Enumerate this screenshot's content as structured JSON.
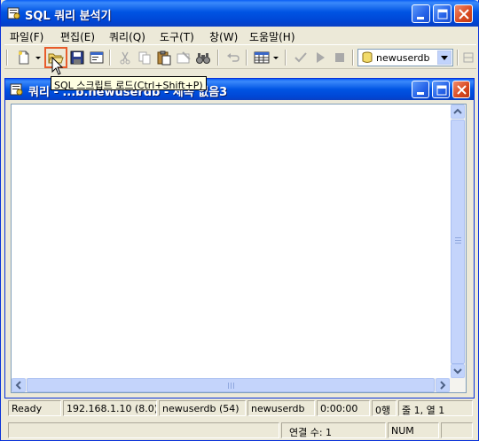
{
  "window": {
    "title": "SQL 쿼리 분석기"
  },
  "menu": [
    "파일(F)",
    "편집(E)",
    "쿼리(Q)",
    "도구(T)",
    "창(W)",
    "도움말(H)"
  ],
  "toolbar": {
    "database": "newuserdb"
  },
  "tooltip": "SQL 스크립트 로드(Ctrl+Shift+P)",
  "child": {
    "title": "쿼리 - ...b.newuserdb - 제목 없음3"
  },
  "status": {
    "state": "Ready",
    "server": "192.168.1.10 (8.0)",
    "user": "newuserdb (54)",
    "db": "newuserdb",
    "time": "0:00:00",
    "rows": "0행",
    "pos": "줄 1, 열 1"
  },
  "appstatus": {
    "conn": "연결 수: 1",
    "num": "NUM"
  }
}
